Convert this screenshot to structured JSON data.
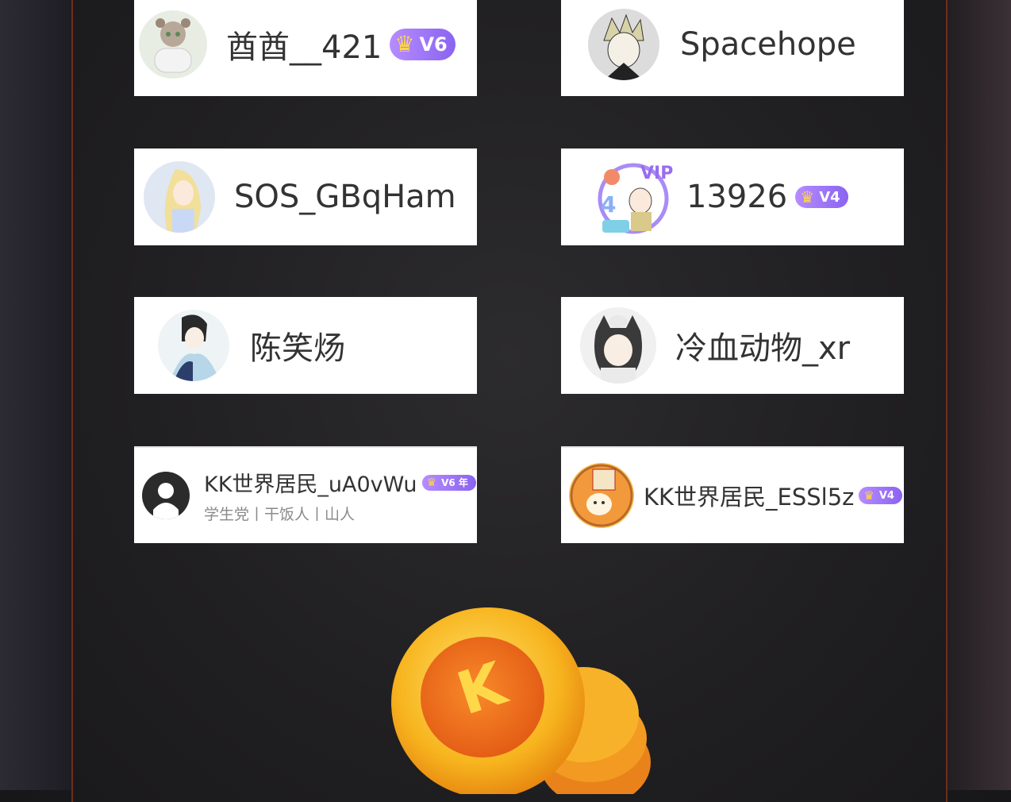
{
  "users": [
    {
      "name": "酋酋__421",
      "vip": "V6",
      "subtitle": ""
    },
    {
      "name": "Spacehope",
      "vip": "",
      "subtitle": ""
    },
    {
      "name": "SOS_GBqHam",
      "vip": "",
      "subtitle": ""
    },
    {
      "name": "13926",
      "vip": "V4",
      "subtitle": ""
    },
    {
      "name": "陈笑炀",
      "vip": "",
      "subtitle": ""
    },
    {
      "name": "冷血动物_xr",
      "vip": "",
      "subtitle": ""
    },
    {
      "name": "KK世界居民_uA0vWu",
      "vip": "V6 年",
      "subtitle": "学生党丨干饭人丨山人"
    },
    {
      "name": "KK世界居民_ESSl5z",
      "vip": "V4",
      "subtitle": ""
    }
  ],
  "coin": {
    "letter": "K"
  },
  "colors": {
    "accent": "#8a63f0",
    "coin": "#f6a51c",
    "border": "#6e2e1c"
  }
}
